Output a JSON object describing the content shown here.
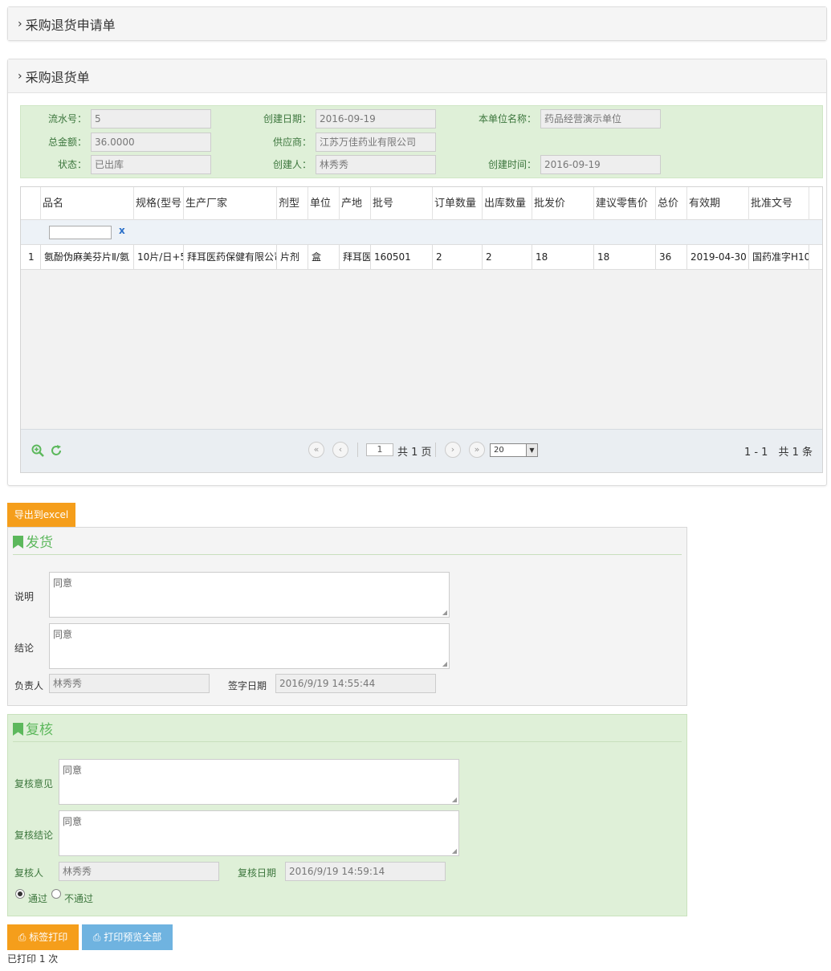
{
  "panel_apply": {
    "title": "采购退货申请单"
  },
  "panel_return": {
    "title": "采购退货单"
  },
  "info": {
    "serial_label": "流水号：",
    "serial": "5",
    "create_date_label": "创建日期：",
    "create_date": "2016-09-19",
    "unit_label": "本单位名称：",
    "unit": "药品经营演示单位",
    "amount_label": "总金额：",
    "amount": "36.0000",
    "supplier_label": "供应商：",
    "supplier": "江苏万佳药业有限公司",
    "status_label": "状态：",
    "status": "已出库",
    "creator_label": "创建人：",
    "creator": "林秀秀",
    "create_time_label": "创建时间：",
    "create_time": "2016-09-19"
  },
  "grid": {
    "headers": [
      "品名",
      "规格(型号",
      "生产厂家",
      "剂型",
      "单位",
      "产地",
      "批号",
      "订单数量",
      "出库数量",
      "批发价",
      "建议零售价",
      "总价",
      "有效期",
      "批准文号"
    ],
    "filter_clear": "x",
    "row": [
      "1",
      "氨酚伪麻美芬片Ⅱ/氨",
      "10片/日+5",
      "拜耳医药保健有限公司",
      "片剂",
      "盒",
      "拜耳医",
      "160501",
      "2",
      "2",
      "18",
      "18",
      "36",
      "2019-04-30",
      "国药准字H10"
    ],
    "pager": {
      "page": "1",
      "total_pages": "共 1 页",
      "page_size": "20",
      "range": "1 - 1　共 1 条"
    }
  },
  "export_label": "导出到excel",
  "ship": {
    "title": "发货",
    "desc_label": "说明",
    "desc": "同意",
    "conclusion_label": "结论",
    "conclusion": "同意",
    "owner_label": "负责人",
    "owner": "林秀秀",
    "sign_date_label": "签字日期",
    "sign_date": "2016/9/19 14:55:44"
  },
  "review": {
    "title": "复核",
    "opinion_label": "复核意见",
    "opinion": "同意",
    "conclusion_label": "复核结论",
    "conclusion": "同意",
    "reviewer_label": "复核人",
    "reviewer": "林秀秀",
    "date_label": "复核日期",
    "date": "2016/9/19 14:59:14",
    "pass_label": "通过",
    "fail_label": "不通过",
    "selected": "通过"
  },
  "actions": {
    "label_print": "标签打印",
    "preview_all": "打印预览全部",
    "printed_count": "已打印 1 次"
  },
  "colors": {
    "accent_orange": "#f59e1b",
    "accent_blue": "#6fb3e0",
    "green": "#5cb85c",
    "info_bg": "#dff0d8"
  },
  "icons": [
    "chevron-right-icon",
    "zoom-in-icon",
    "refresh-icon",
    "first-page-icon",
    "prev-page-icon",
    "next-page-icon",
    "last-page-icon",
    "bookmark-icon",
    "printer-icon",
    "resize-grip-icon"
  ]
}
